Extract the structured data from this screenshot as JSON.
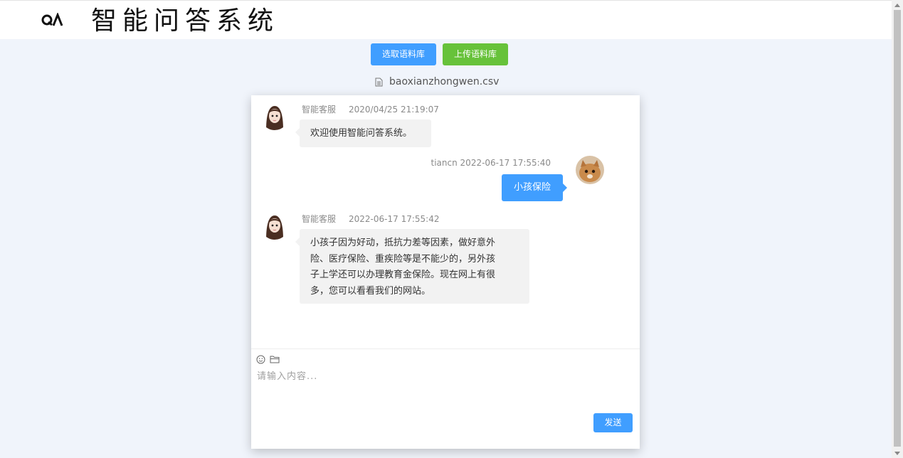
{
  "header": {
    "title": "智能问答系统",
    "logo_text": "QA"
  },
  "toolbar": {
    "select_label": "选取语料库",
    "upload_label": "上传语料库",
    "file_name": "baoxianzhongwen.csv"
  },
  "colors": {
    "primary": "#409eff",
    "success": "#67c23a",
    "page_bg": "#f0f4fb",
    "bubble_bg": "#f2f2f2"
  },
  "messages": [
    {
      "side": "left",
      "sender": "智能客服",
      "time": "2020/04/25 21:19:07",
      "lines": [
        "欢迎使用智能问答系统。"
      ]
    },
    {
      "side": "right",
      "sender": "tiancn",
      "time": "2022-06-17 17:55:40",
      "lines": [
        "小孩保险"
      ]
    },
    {
      "side": "left",
      "sender": "智能客服",
      "time": "2022-06-17 17:55:42",
      "lines": [
        "小孩子因为好动，抵抗力差等因素，做好意外",
        "险、医疗保险、重疾险等是不能少的，另外孩",
        "子上学还可以办理教育金保险。现在网上有很",
        "多，您可以看看我们的网站。"
      ]
    }
  ],
  "composer": {
    "placeholder": "请输入内容...",
    "value": "",
    "send_label": "发送",
    "icons": [
      "smiley-icon",
      "folder-icon"
    ]
  }
}
